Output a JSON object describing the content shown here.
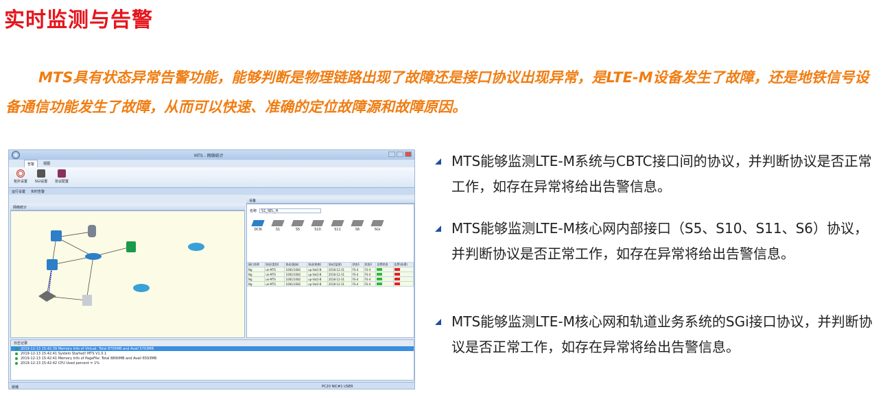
{
  "title": "实时监测与告警",
  "intro": "MTS具有状态异常告警功能，能够判断是物理链路出现了故障还是接口协议出现异常，是LTE-M设备发生了故障，还是地铁信号设备通信功能发生了故障，从而可以快速、准确的定位故障源和故障原因。",
  "screenshot": {
    "window_title": "MTS - 网络统计",
    "tabs": [
      "告警",
      "视图"
    ],
    "ribbon_buttons": [
      "拓扑设置",
      "SGI设置",
      "协议配置"
    ],
    "subtabs": [
      "运行设置",
      "实时告警"
    ],
    "topology_header": "网络统计",
    "device_header": "设备",
    "search_label": "名称",
    "search_value": "S1_SEL_H",
    "device_icons": [
      "DCN",
      "S1",
      "S5",
      "S10",
      "S11",
      "S6",
      "SGi"
    ],
    "table_headers": [
      "接口名称",
      "协议(类别)",
      "协议(起始)",
      "协议(结束)",
      "协议(监测)",
      "状态1",
      "状态2",
      "告警状态",
      "告警(处理)"
    ],
    "table_rows": [
      [
        "Ng",
        "uk-MTS",
        "1081/1082",
        "up-Vat2-B",
        "2018-12-31",
        "FS-4",
        "FS-4",
        "ok",
        "bad"
      ],
      [
        "Ng",
        "uk-MTS",
        "1081/1082",
        "up-Vat2-B",
        "2018-12-31",
        "FS-4",
        "FS-4",
        "ok",
        "bad"
      ],
      [
        "Ng",
        "uk-MTS",
        "1081/1082",
        "up-Vat2-B",
        "2018-12-31",
        "FS-4",
        "FS-4",
        "ok",
        "bad"
      ],
      [
        "Ng",
        "uk-MTS",
        "1081/1082",
        "up-Vat2-B",
        "2018-12-31",
        "FS-4",
        "FS-4",
        "ok",
        "bad"
      ]
    ],
    "log_header": "日志记录",
    "log_rows": [
      "2019-12-13 15:42:39   Memory Info of Virtual: Total 8705MB and Avail 5703MB",
      "2019-12-13 15:42:41   System Started! MTS V1.0.1",
      "2019-12-13 15:42:41   Memory Info of PageFile: Total 8890MB and Avail 6593MB",
      "2019-12-13 15:42:42   CPU Used percent = 1%"
    ],
    "status_left": "就绪",
    "status_right": "PC20 NIC#1 USER"
  },
  "bullets": [
    "MTS能够监测LTE-M系统与CBTC接口间的协议，并判断协议是否正常工作，如存在异常将给出告警信息。",
    "MTS能够监测LTE-M核心网内部接口（S5、S10、S11、S6）协议，并判断协议是否正常工作，如存在异常将给出告警信息。",
    "MTS能够监测LTE-M核心网和轨道业务系统的SGi接口协议，并判断协议是否正常工作，如存在异常将给出告警信息。"
  ],
  "colors": {
    "title": "#e5141b",
    "intro": "#f07d12",
    "bullet_marker": "#1f4ea3"
  },
  "icons": [
    "triangle-bullet-icon",
    "network-switch-icon",
    "database-icon",
    "server-icon",
    "router-icon"
  ]
}
